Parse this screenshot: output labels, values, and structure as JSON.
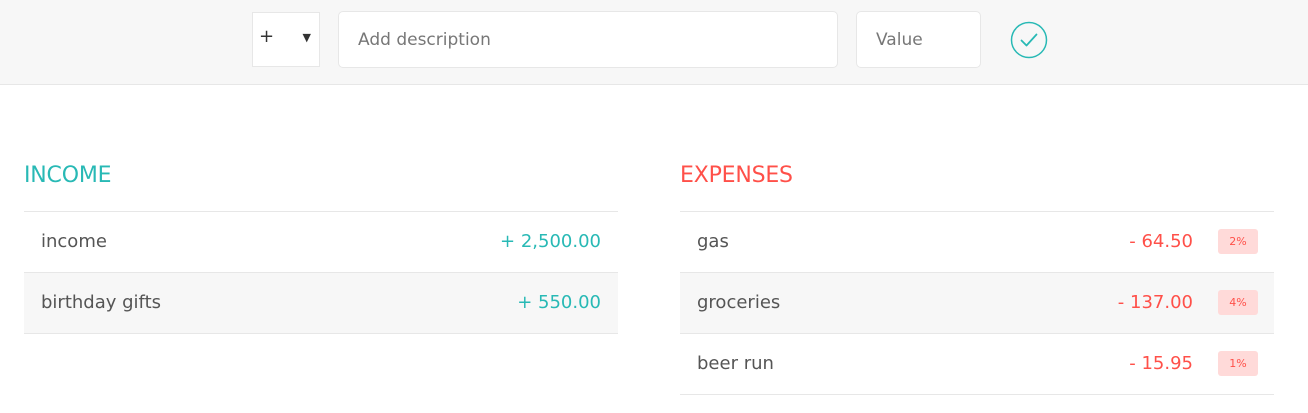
{
  "add_form": {
    "type_options": [
      "+",
      "-"
    ],
    "type_selected": "+",
    "description_placeholder": "Add description",
    "value_placeholder": "Value",
    "submit_icon": "check-circle-icon"
  },
  "income": {
    "title": "INCOME",
    "items": [
      {
        "description": "income",
        "amount": "+ 2,500.00"
      },
      {
        "description": "birthday gifts",
        "amount": "+ 550.00"
      }
    ]
  },
  "expenses": {
    "title": "EXPENSES",
    "items": [
      {
        "description": "gas",
        "amount": "- 64.50",
        "percentage": "2%"
      },
      {
        "description": "groceries",
        "amount": "- 137.00",
        "percentage": "4%"
      },
      {
        "description": "beer run",
        "amount": "- 15.95",
        "percentage": "1%"
      }
    ]
  },
  "colors": {
    "income": "#28b9b5",
    "expense": "#ff5049",
    "percentage_bg": "#ffdad9",
    "bar_bg": "#f7f7f7"
  }
}
